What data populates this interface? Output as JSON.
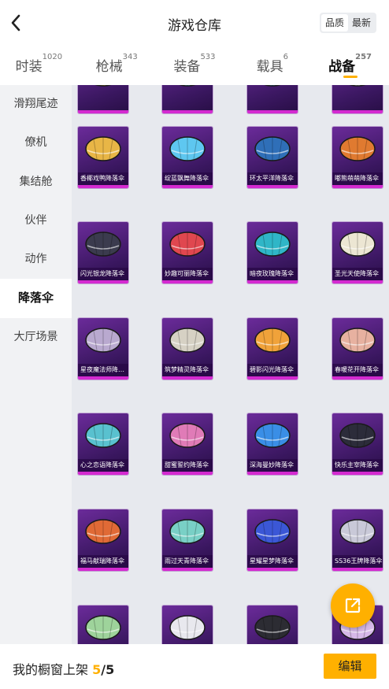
{
  "header": {
    "title": "游戏仓库",
    "sort_options": [
      "品质",
      "最新"
    ],
    "sort_selected": "品质"
  },
  "tabs": [
    {
      "label": "时装",
      "count": "1020"
    },
    {
      "label": "枪械",
      "count": "343"
    },
    {
      "label": "装备",
      "count": "533"
    },
    {
      "label": "载具",
      "count": "6"
    },
    {
      "label": "战备",
      "count": "257"
    }
  ],
  "sidebar": {
    "items": [
      {
        "label": "滑翔尾迹"
      },
      {
        "label": "僚机"
      },
      {
        "label": "集结舱"
      },
      {
        "label": "伙伴"
      },
      {
        "label": "动作"
      },
      {
        "label": "降落伞"
      },
      {
        "label": "大厅场景"
      }
    ]
  },
  "grid": {
    "items": [
      {
        "name": "",
        "color": "#e8b646"
      },
      {
        "name": "",
        "color": "#5ec7f0"
      },
      {
        "name": "",
        "color": "#3a8fd6"
      },
      {
        "name": "",
        "color": "#f2f2f2"
      },
      {
        "name": "香椰戏鸭降落伞",
        "color": "#e8b646"
      },
      {
        "name": "绽蓝飘舞降落伞",
        "color": "#5ec7f0"
      },
      {
        "name": "环太平洋降落伞",
        "color": "#2f6fb8"
      },
      {
        "name": "嘟熊萌萌降落伞",
        "color": "#e07a30"
      },
      {
        "name": "闪光银龙降落伞",
        "color": "#3b3b4e"
      },
      {
        "name": "妙趣可丽降落伞",
        "color": "#e0474f"
      },
      {
        "name": "暗夜玫瑰降落伞",
        "color": "#2fb6c7"
      },
      {
        "name": "圣光天使降落伞",
        "color": "#ece6d3"
      },
      {
        "name": "星夜魔法师降落伞",
        "color": "#b9a9cf"
      },
      {
        "name": "筑梦精灵降落伞",
        "color": "#d6d1c4"
      },
      {
        "name": "碧影闪光降落伞",
        "color": "#f0a23a"
      },
      {
        "name": "春暖花开降落伞",
        "color": "#e7b1a0"
      },
      {
        "name": "心之恋语降落伞",
        "color": "#59c1cf"
      },
      {
        "name": "甜蜜誓约降落伞",
        "color": "#e07bb7"
      },
      {
        "name": "深海曼妙降落伞",
        "color": "#3a8ee6"
      },
      {
        "name": "快乐主宰降落伞",
        "color": "#2c2c3a"
      },
      {
        "name": "福马献瑞降落伞",
        "color": "#e06a36"
      },
      {
        "name": "雨过天青降落伞",
        "color": "#79d0c6"
      },
      {
        "name": "星耀星梦降落伞",
        "color": "#3b57d6"
      },
      {
        "name": "SS36王牌降落伞",
        "color": "#c9c9d8"
      },
      {
        "name": "",
        "color": "#9ed39b"
      },
      {
        "name": "",
        "color": "#e8e8ee"
      },
      {
        "name": "",
        "color": "#2c2c33"
      },
      {
        "name": "",
        "color": "#d6b8e8"
      }
    ]
  },
  "footer": {
    "label": "我的橱窗上架",
    "count": "5",
    "separator": "/",
    "total": "5",
    "edit_label": "编辑"
  },
  "icons": {
    "back": "chevron-left-icon",
    "share": "external-link-icon"
  },
  "colors": {
    "accent": "#ffb000",
    "card_bg": "#4a1d78",
    "card_border": "#d42ad0"
  }
}
